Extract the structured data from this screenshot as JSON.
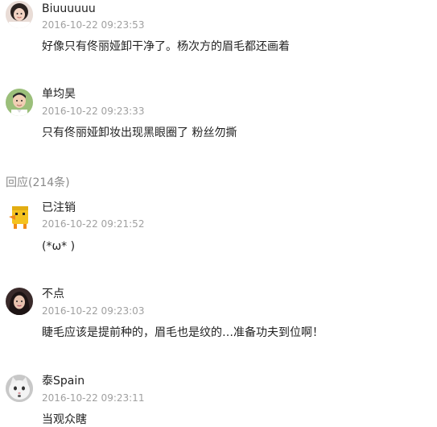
{
  "comments_top": [
    {
      "username": "Biuuuuuu",
      "timestamp": "2016-10-22 09:23:53",
      "text": "好像只有佟丽娅卸干净了。杨次方的眉毛都还画着"
    },
    {
      "username": "单均昊",
      "timestamp": "2016-10-22 09:23:33",
      "text": "只有佟丽娅卸妆出现黑眼圈了 粉丝勿撕"
    }
  ],
  "replies_header": "回应(214条)",
  "comments_replies": [
    {
      "username": "已注销",
      "timestamp": "2016-10-22 09:21:52",
      "text": "(*ω* )"
    },
    {
      "username": "不点",
      "timestamp": "2016-10-22 09:23:03",
      "text": "睫毛应该是提前种的，眉毛也是纹的…准备功夫到位啊！"
    },
    {
      "username": "泰Spain",
      "timestamp": "2016-10-22 09:23:11",
      "text": "当观众瞎"
    }
  ],
  "avatars": {
    "c1": "girl-photo-icon",
    "c2": "man-photo-icon",
    "c3": "yellow-duck-icon",
    "c4": "woman-photo-icon",
    "c5": "white-cat-photo-icon"
  }
}
